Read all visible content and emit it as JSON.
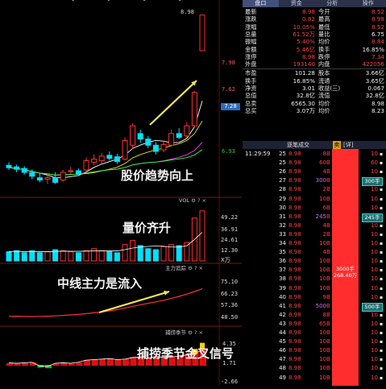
{
  "chart": {
    "top_dots": "• • • •",
    "max_price_label": "8.98",
    "price_axis": [
      "7.98",
      "7.62",
      "7.28",
      "6.93"
    ],
    "current_price_box": "7.28",
    "vol_title": "VOL",
    "vol_axis": [
      "49.22",
      "36.91",
      "24.61",
      "12.30",
      "X万"
    ],
    "main_force_title": "主力追踪",
    "mf_axis": [
      "75.10",
      "66.23",
      "57.36",
      "48.50"
    ],
    "season_title": "捕捞季节",
    "season_axis": [
      "4.35",
      "1.71",
      "-2.66"
    ],
    "annotations": {
      "price_trend": "股价趋势向上",
      "volume_price": "量价齐升",
      "main_force": "中线主力是流入",
      "season_signal": "捕捞季节金叉信号"
    },
    "colors": {
      "up": "#ff3030",
      "down": "#00e0ff",
      "ma1": "#ffffff",
      "ma2": "#e6e600",
      "ma3": "#ff40ff",
      "ma4": "#30ff30"
    }
  },
  "panel": {
    "tabs": [
      "盘口",
      "资金",
      "分析",
      "操作"
    ],
    "quote_rows": [
      {
        "l1": "最新",
        "v1": "8.98",
        "l2": "今开",
        "v2": "8.52"
      },
      {
        "l1": "涨跌",
        "v1": "0.82",
        "l2": "最高",
        "v2": "8.98"
      },
      {
        "l1": "涨幅",
        "v1": "10.05%",
        "l2": "最低",
        "v2": "8.52"
      },
      {
        "l1": "总量",
        "v1": "61.52万",
        "l2": "量比",
        "v2": "6.75"
      },
      {
        "l1": "振幅",
        "v1": "5.40%",
        "l2": "均价",
        "v2": "8.84"
      },
      {
        "l1": "金额",
        "v1": "5.46亿",
        "l2": "换手",
        "v2": "16.85%"
      },
      {
        "l1": "涨停",
        "v1": "8.98",
        "l2": "跌停",
        "v2": "7.34"
      },
      {
        "l1": "外盘",
        "v1": "193140",
        "l2": "内盘",
        "v2": "422056"
      }
    ],
    "fund_rows": [
      {
        "l1": "市盈",
        "v1": "101.28",
        "l2": "股本",
        "v2": "3.66亿"
      },
      {
        "l1": "换手",
        "v1": "16.85%",
        "l2": "流通",
        "v2": "3.65亿"
      },
      {
        "l1": "净资",
        "v1": "3.01",
        "l2": "收益(三)",
        "v2": "0.067"
      },
      {
        "l1": "总值",
        "v1": "32.8亿",
        "l2": "流值",
        "v2": "32.8亿"
      },
      {
        "l1": "总卖",
        "v1": "6565.30",
        "l2": "均价",
        "v2": "8.98"
      },
      {
        "l1": "总买",
        "v1": "3.07万",
        "l2": "均价",
        "v2": "8.23"
      }
    ],
    "tick_header": {
      "title": "逐笔成交",
      "detail": "[详]",
      "flag": "卖"
    },
    "ticks": [
      {
        "t": "11:29:59",
        "n": "25",
        "p": "8.98",
        "v": "8",
        "s": "B",
        "c": "10"
      },
      {
        "t": "",
        "n": "25",
        "p": "8.98",
        "v": "60",
        "s": "B",
        "c": "60"
      },
      {
        "t": "",
        "n": "26",
        "p": "8.98",
        "v": "4",
        "s": "B",
        "c": "10"
      },
      {
        "t": "",
        "n": "27",
        "p": "8.98",
        "v": "300",
        "s": "B",
        "c": "300手"
      },
      {
        "t": "",
        "n": "28",
        "p": "8.98",
        "v": "2",
        "s": "B",
        "c": "10"
      },
      {
        "t": "",
        "n": "29",
        "p": "8.98",
        "v": "10",
        "s": "B",
        "c": "10"
      },
      {
        "t": "",
        "n": "30",
        "p": "8.98",
        "v": "6",
        "s": "B",
        "c": "10"
      },
      {
        "t": "",
        "n": "31",
        "p": "8.98",
        "v": "245",
        "s": "B",
        "c": "245手"
      },
      {
        "t": "",
        "n": "32",
        "p": "8.98",
        "v": "4",
        "s": "B",
        "c": "10"
      },
      {
        "t": "",
        "n": "33",
        "p": "8.98",
        "v": "2",
        "s": "B",
        "c": "10"
      },
      {
        "t": "",
        "n": "34",
        "p": "8.98",
        "v": "10",
        "s": "B",
        "c": "10"
      },
      {
        "t": "",
        "n": "35",
        "p": "8.98",
        "v": "4",
        "s": "B",
        "c": "10"
      },
      {
        "t": "",
        "n": "36",
        "p": "8.98",
        "v": "10",
        "s": "B",
        "c": "10"
      },
      {
        "t": "",
        "n": "37",
        "p": "8.98",
        "v": "10",
        "s": "B",
        "c": "10"
      },
      {
        "t": "",
        "n": "38",
        "p": "8.98",
        "v": "10",
        "s": "B",
        "c": "10"
      },
      {
        "t": "",
        "n": "39",
        "p": "8.98",
        "v": "10",
        "s": "B",
        "c": "10"
      },
      {
        "t": "",
        "n": "40",
        "p": "8.98",
        "v": "9",
        "s": "B",
        "c": "10"
      },
      {
        "t": "",
        "n": "41",
        "p": "8.98",
        "v": "500",
        "s": "B",
        "c": "500手"
      },
      {
        "t": "",
        "n": "42",
        "p": "8.98",
        "v": "8",
        "s": "B",
        "c": "10"
      },
      {
        "t": "",
        "n": "43",
        "p": "8.98",
        "v": "65",
        "s": "B",
        "c": "10"
      },
      {
        "t": "",
        "n": "44",
        "p": "8.98",
        "v": "10",
        "s": "B",
        "c": "10"
      },
      {
        "t": "",
        "n": "45",
        "p": "8.98",
        "v": "10",
        "s": "B",
        "c": "10"
      },
      {
        "t": "",
        "n": "46",
        "p": "8.98",
        "v": "10",
        "s": "B",
        "c": "10"
      },
      {
        "t": "",
        "n": "47",
        "p": "8.98",
        "v": "10",
        "s": "B",
        "c": "10"
      },
      {
        "t": "",
        "n": "48",
        "p": "8.98",
        "v": "10",
        "s": "B",
        "c": "10"
      },
      {
        "t": "",
        "n": "49",
        "p": "8.98",
        "v": "10",
        "s": "B",
        "c": "10"
      }
    ],
    "big_trade": {
      "line1": "3000手",
      "line2": "268.40万"
    }
  },
  "chart_data": {
    "type": "candlestick",
    "title": "",
    "price_ylim": [
      6.7,
      9.05
    ],
    "candles": [
      {
        "o": 7.04,
        "c": 7.01,
        "h": 7.08,
        "l": 6.98
      },
      {
        "o": 7.02,
        "c": 6.99,
        "h": 7.05,
        "l": 6.95
      },
      {
        "o": 7.0,
        "c": 6.95,
        "h": 7.03,
        "l": 6.92
      },
      {
        "o": 6.95,
        "c": 6.9,
        "h": 6.99,
        "l": 6.86
      },
      {
        "o": 6.88,
        "c": 6.85,
        "h": 6.94,
        "l": 6.82
      },
      {
        "o": 6.86,
        "c": 6.88,
        "h": 6.92,
        "l": 6.8
      },
      {
        "o": 6.88,
        "c": 6.82,
        "h": 6.95,
        "l": 6.8
      },
      {
        "o": 6.85,
        "c": 6.95,
        "h": 6.98,
        "l": 6.83
      },
      {
        "o": 6.96,
        "c": 6.97,
        "h": 7.02,
        "l": 6.93
      },
      {
        "o": 6.97,
        "c": 6.93,
        "h": 7.0,
        "l": 6.9
      },
      {
        "o": 6.98,
        "c": 7.1,
        "h": 7.14,
        "l": 6.95
      },
      {
        "o": 7.08,
        "c": 7.12,
        "h": 7.18,
        "l": 7.04
      },
      {
        "o": 7.1,
        "c": 7.16,
        "h": 7.2,
        "l": 7.06
      },
      {
        "o": 7.17,
        "c": 7.13,
        "h": 7.22,
        "l": 7.1
      },
      {
        "o": 7.15,
        "c": 7.09,
        "h": 7.19,
        "l": 7.06
      },
      {
        "o": 7.12,
        "c": 7.36,
        "h": 7.4,
        "l": 7.1
      },
      {
        "o": 7.3,
        "c": 7.55,
        "h": 7.58,
        "l": 7.25
      },
      {
        "o": 7.45,
        "c": 7.38,
        "h": 7.5,
        "l": 7.33
      },
      {
        "o": 7.38,
        "c": 7.3,
        "h": 7.42,
        "l": 7.26
      },
      {
        "o": 7.3,
        "c": 7.22,
        "h": 7.34,
        "l": 7.18
      },
      {
        "o": 7.24,
        "c": 7.31,
        "h": 7.36,
        "l": 7.21
      },
      {
        "o": 7.3,
        "c": 7.45,
        "h": 7.5,
        "l": 7.28
      },
      {
        "o": 7.45,
        "c": 7.4,
        "h": 7.52,
        "l": 7.38
      },
      {
        "o": 7.42,
        "c": 7.55,
        "h": 7.6,
        "l": 7.4
      },
      {
        "o": 7.55,
        "c": 7.98,
        "h": 8.0,
        "l": 7.53
      },
      {
        "o": 8.52,
        "c": 8.98,
        "h": 8.98,
        "l": 8.52
      }
    ],
    "volume": [
      9,
      10,
      8,
      10,
      8,
      9,
      11,
      10,
      9,
      8,
      10,
      12,
      10,
      9,
      8,
      16,
      20,
      15,
      12,
      11,
      14,
      16,
      15,
      18,
      42,
      49
    ],
    "vol_ylim": [
      0,
      52
    ],
    "main_force": [
      50.6,
      50.7,
      50.6,
      50.5,
      50.6,
      50.7,
      50.9,
      51.2,
      51.5,
      51.8,
      52.3,
      52.8,
      53.3,
      54.0,
      54.8,
      55.8,
      56.8,
      57.8,
      58.7,
      59.6,
      60.6,
      61.8,
      63.0,
      64.4,
      66.0,
      67.8
    ],
    "mf_ylim": [
      46,
      78
    ],
    "season_hist": [
      0.3,
      0.2,
      0.3,
      0.4,
      -0.3,
      -0.4,
      0.2,
      0.3,
      0.2,
      0.4,
      0.8,
      0.9,
      1.0,
      1.1,
      0.9,
      1.0,
      1.3,
      1.4,
      1.2,
      1.5,
      1.3,
      1.4,
      1.6,
      1.8,
      2.2,
      2.6
    ],
    "season_ylim": [
      -3.0,
      5.0
    ]
  }
}
